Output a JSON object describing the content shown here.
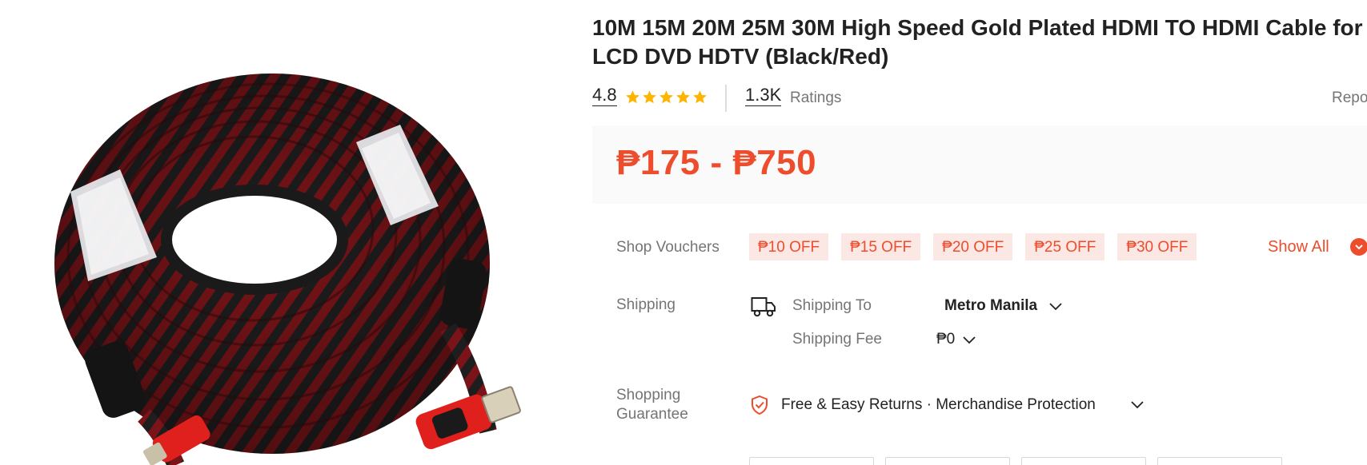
{
  "product": {
    "title": "10M 15M 20M 25M 30M High Speed Gold Plated HDMI TO HDMI Cable for LCD DVD HDTV (Black/Red)",
    "image_alt": "HDMI cable coiled, black and red braided",
    "rating": "4.8",
    "stars_filled": 5,
    "ratings_count": "1.3K",
    "ratings_label": "Ratings",
    "report_label": "Report",
    "price": "₱175 - ₱750"
  },
  "vouchers": {
    "label": "Shop Vouchers",
    "items": [
      "₱10 OFF",
      "₱15 OFF",
      "₱20 OFF",
      "₱25 OFF",
      "₱30 OFF"
    ],
    "show_all": "Show All"
  },
  "shipping": {
    "label": "Shipping",
    "to_label": "Shipping To",
    "destination": "Metro Manila",
    "fee_label": "Shipping Fee",
    "fee_value": "₱0"
  },
  "guarantee": {
    "label_line1": "Shopping",
    "label_line2": "Guarantee",
    "text": "Free & Easy Returns · Merchandise Protection"
  },
  "colors": {
    "accent": "#ee4d2d",
    "star": "#ffb400",
    "voucher_bg": "#fbe7e4",
    "price_bg": "#fafafa"
  },
  "icons": {
    "rating": "star-icon",
    "truck": "truck-icon",
    "shield": "shield-icon",
    "chevron": "chevron-down-icon"
  }
}
